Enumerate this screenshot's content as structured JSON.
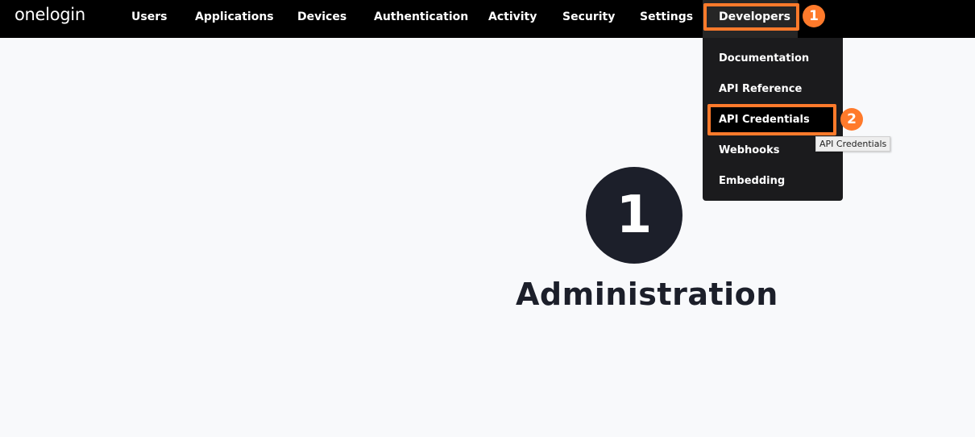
{
  "brand": {
    "logo_text": "onelogin",
    "accent_color": "#ff7a2b"
  },
  "nav": {
    "items": [
      "Users",
      "Applications",
      "Devices",
      "Authentication",
      "Activity",
      "Security",
      "Settings"
    ],
    "active": "Developers"
  },
  "developers_menu": {
    "items": [
      "Documentation",
      "API Reference",
      "API Credentials",
      "Webhooks",
      "Embedding"
    ],
    "highlighted": "API Credentials",
    "tooltip": "API Credentials"
  },
  "annotations": {
    "step1": "1",
    "step2": "2"
  },
  "hero": {
    "number": "1",
    "title": "Administration"
  }
}
